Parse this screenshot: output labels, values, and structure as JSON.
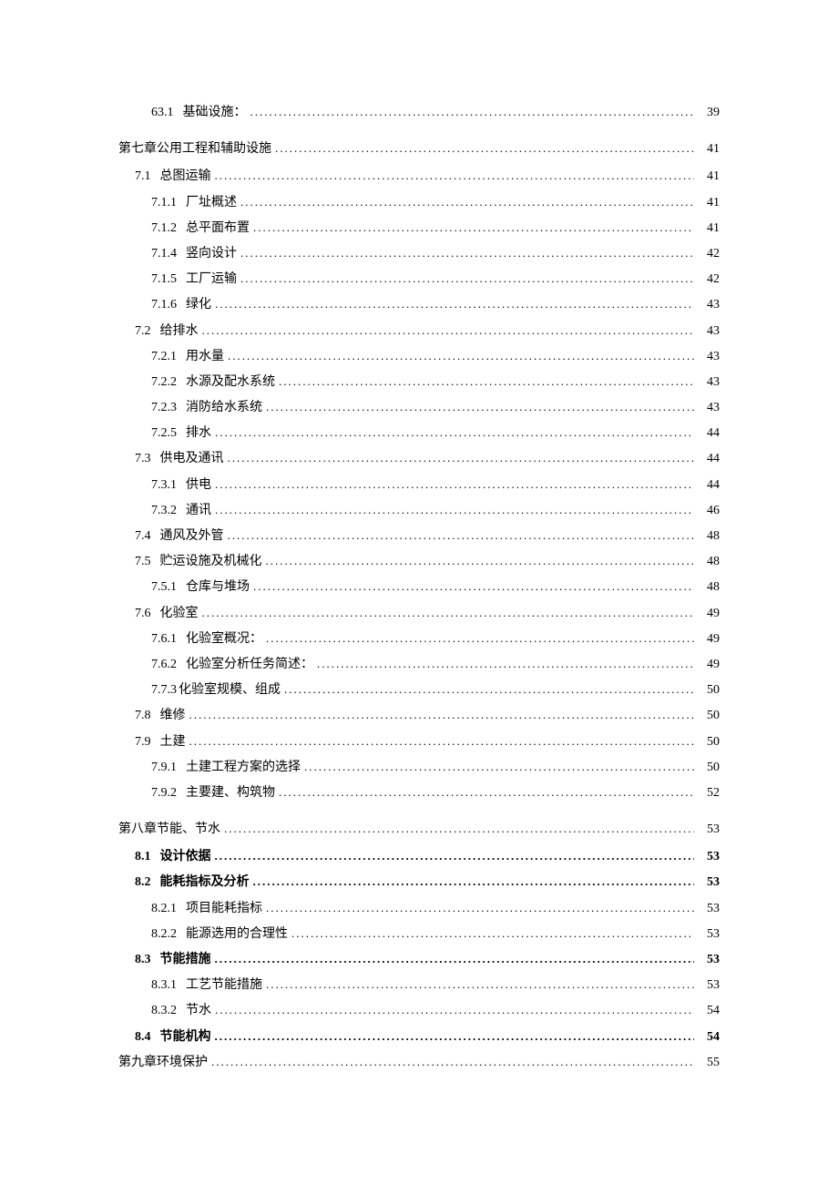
{
  "toc": [
    {
      "level": 2,
      "num": "63.1",
      "title": "基础设施：",
      "page": "39",
      "bold": false,
      "gap": "none"
    },
    {
      "level": 0,
      "num": "",
      "title": "第七章公用工程和辅助设施",
      "page": "41",
      "bold": false,
      "gap": "chapter"
    },
    {
      "level": 1,
      "num": "7.1",
      "title": "总图运输",
      "page": "41",
      "bold": false,
      "gap": "section"
    },
    {
      "level": 2,
      "num": "7.1.1",
      "title": "厂址概述",
      "page": "41",
      "bold": false,
      "gap": "none"
    },
    {
      "level": 2,
      "num": "7.1.2",
      "title": "总平面布置",
      "page": "41",
      "bold": false,
      "gap": "none"
    },
    {
      "level": 2,
      "num": "7.1.4",
      "title": "竖向设计",
      "page": "42",
      "bold": false,
      "gap": "none"
    },
    {
      "level": 2,
      "num": "7.1.5",
      "title": "工厂运输",
      "page": "42",
      "bold": false,
      "gap": "none"
    },
    {
      "level": 2,
      "num": "7.1.6",
      "title": "绿化",
      "page": "43",
      "bold": false,
      "gap": "none"
    },
    {
      "level": 1,
      "num": "7.2",
      "title": "给排水",
      "page": "43",
      "bold": false,
      "gap": "none"
    },
    {
      "level": 2,
      "num": "7.2.1",
      "title": "用水量",
      "page": "43",
      "bold": false,
      "gap": "none"
    },
    {
      "level": 2,
      "num": "7.2.2",
      "title": "水源及配水系统",
      "page": "43",
      "bold": false,
      "gap": "none"
    },
    {
      "level": 2,
      "num": "7.2.3",
      "title": "消防给水系统",
      "page": "43",
      "bold": false,
      "gap": "none"
    },
    {
      "level": 2,
      "num": "7.2.5",
      "title": "排水",
      "page": "44",
      "bold": false,
      "gap": "none"
    },
    {
      "level": 1,
      "num": "7.3",
      "title": "供电及通讯",
      "page": "44",
      "bold": false,
      "gap": "none"
    },
    {
      "level": 2,
      "num": "7.3.1",
      "title": "供电",
      "page": "44",
      "bold": false,
      "gap": "none"
    },
    {
      "level": 2,
      "num": "7.3.2",
      "title": "通讯",
      "page": "46",
      "bold": false,
      "gap": "none"
    },
    {
      "level": 1,
      "num": "7.4",
      "title": "通风及外管",
      "page": "48",
      "bold": false,
      "gap": "none"
    },
    {
      "level": 1,
      "num": "7.5",
      "title": "贮运设施及机械化",
      "page": "48",
      "bold": false,
      "gap": "none"
    },
    {
      "level": 2,
      "num": "7.5.1",
      "title": "仓库与堆场",
      "page": "48",
      "bold": false,
      "gap": "none"
    },
    {
      "level": 1,
      "num": "7.6",
      "title": "化验室",
      "page": "49",
      "bold": false,
      "gap": "none"
    },
    {
      "level": 2,
      "num": "7.6.1",
      "title": "化验室概况：",
      "page": "49",
      "bold": false,
      "gap": "none"
    },
    {
      "level": 2,
      "num": "7.6.2",
      "title": "化验室分析任务简述：",
      "page": "49",
      "bold": false,
      "gap": "none"
    },
    {
      "level": 2,
      "num": "7.7.3",
      "title": "化验室规模、组成",
      "page": "50",
      "bold": false,
      "gap": "none",
      "nosep": true
    },
    {
      "level": 1,
      "num": "7.8",
      "title": "维修",
      "page": "50",
      "bold": false,
      "gap": "none"
    },
    {
      "level": 1,
      "num": "7.9",
      "title": "土建",
      "page": "50",
      "bold": false,
      "gap": "none"
    },
    {
      "level": 2,
      "num": "7.9.1",
      "title": "土建工程方案的选择",
      "page": "50",
      "bold": false,
      "gap": "none"
    },
    {
      "level": 2,
      "num": "7.9.2",
      "title": "主要建、构筑物",
      "page": "52",
      "bold": false,
      "gap": "none"
    },
    {
      "level": 0,
      "num": "",
      "title": "第八章节能、节水",
      "page": "53",
      "bold": false,
      "gap": "chapter"
    },
    {
      "level": 1,
      "num": "8.1",
      "title": "设计依据",
      "page": "53",
      "bold": true,
      "gap": "section"
    },
    {
      "level": 1,
      "num": "8.2",
      "title": "能耗指标及分析",
      "page": "53",
      "bold": true,
      "gap": "none"
    },
    {
      "level": 2,
      "num": "8.2.1",
      "title": "项目能耗指标",
      "page": "53",
      "bold": false,
      "gap": "none"
    },
    {
      "level": 2,
      "num": "8.2.2",
      "title": "能源选用的合理性",
      "page": "53",
      "bold": false,
      "gap": "none"
    },
    {
      "level": 1,
      "num": "8.3",
      "title": "节能措施",
      "page": "53",
      "bold": true,
      "gap": "none"
    },
    {
      "level": 2,
      "num": "8.3.1",
      "title": "工艺节能措施",
      "page": "53",
      "bold": false,
      "gap": "none"
    },
    {
      "level": 2,
      "num": "8.3.2",
      "title": "节水",
      "page": "54",
      "bold": false,
      "gap": "none"
    },
    {
      "level": 1,
      "num": "8.4",
      "title": "节能机构",
      "page": "54",
      "bold": true,
      "gap": "none"
    },
    {
      "level": 0,
      "num": "",
      "title": "第九章环境保护",
      "page": "55",
      "bold": false,
      "gap": "none"
    }
  ]
}
